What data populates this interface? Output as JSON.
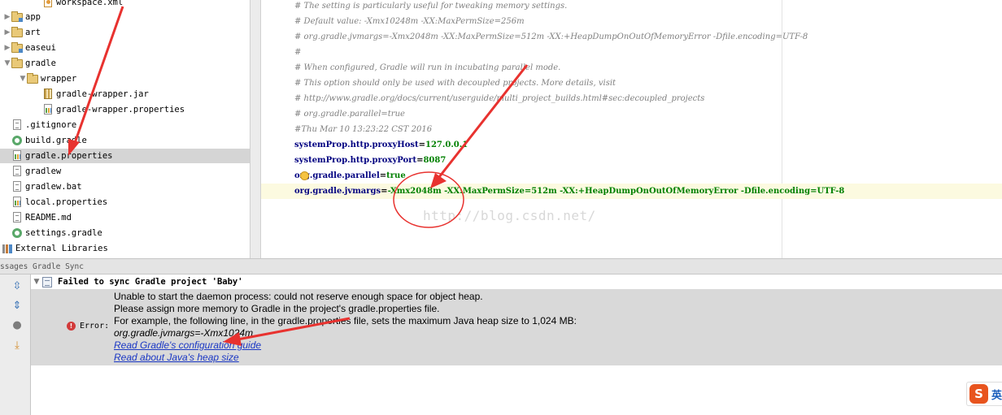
{
  "project_tree": {
    "items": [
      {
        "label": "workspace.xml",
        "icon": "xml-file-icon",
        "indent": 2,
        "expander": ""
      },
      {
        "label": "app",
        "icon": "module-folder-icon",
        "indent": 0,
        "expander": "▶"
      },
      {
        "label": "art",
        "icon": "folder-icon",
        "indent": 0,
        "expander": "▶"
      },
      {
        "label": "easeui",
        "icon": "module-folder-icon",
        "indent": 0,
        "expander": "▶"
      },
      {
        "label": "gradle",
        "icon": "folder-icon",
        "indent": 0,
        "expander": "▼"
      },
      {
        "label": "wrapper",
        "icon": "folder-icon",
        "indent": 1,
        "expander": "▼"
      },
      {
        "label": "gradle-wrapper.jar",
        "icon": "jar-file-icon",
        "indent": 2,
        "expander": ""
      },
      {
        "label": "gradle-wrapper.properties",
        "icon": "properties-file-icon",
        "indent": 2,
        "expander": ""
      },
      {
        "label": ".gitignore",
        "icon": "text-file-icon",
        "indent": 0,
        "expander": ""
      },
      {
        "label": "build.gradle",
        "icon": "gradle-file-icon",
        "indent": 0,
        "expander": ""
      },
      {
        "label": "gradle.properties",
        "icon": "properties-file-icon",
        "indent": 0,
        "expander": "",
        "selected": true
      },
      {
        "label": "gradlew",
        "icon": "text-file-icon",
        "indent": 0,
        "expander": ""
      },
      {
        "label": "gradlew.bat",
        "icon": "text-file-icon",
        "indent": 0,
        "expander": ""
      },
      {
        "label": "local.properties",
        "icon": "properties-file-icon",
        "indent": 0,
        "expander": ""
      },
      {
        "label": "README.md",
        "icon": "text-file-icon",
        "indent": 0,
        "expander": ""
      },
      {
        "label": "settings.gradle",
        "icon": "gradle-file-icon",
        "indent": 0,
        "expander": ""
      },
      {
        "label": "External Libraries",
        "icon": "libraries-icon",
        "indent": -1,
        "expander": ""
      }
    ]
  },
  "editor": {
    "lines": [
      {
        "kind": "comment",
        "text": "# The setting is particularly useful for tweaking memory settings."
      },
      {
        "kind": "comment",
        "text": "# Default value: -Xmx10248m -XX:MaxPermSize=256m"
      },
      {
        "kind": "comment",
        "text": "# org.gradle.jvmargs=-Xmx2048m -XX:MaxPermSize=512m -XX:+HeapDumpOnOutOfMemoryError -Dfile.encoding=UTF-8"
      },
      {
        "kind": "comment",
        "text": "#"
      },
      {
        "kind": "comment",
        "text": "# When configured, Gradle will run in incubating parallel mode."
      },
      {
        "kind": "comment",
        "text": "# This option should only be used with decoupled projects. More details, visit"
      },
      {
        "kind": "comment",
        "text": "# http://www.gradle.org/docs/current/userguide/multi_project_builds.html#sec:decoupled_projects"
      },
      {
        "kind": "comment",
        "text": "# org.gradle.parallel=true"
      },
      {
        "kind": "comment",
        "text": "#Thu Mar 10 13:23:22 CST 2016"
      },
      {
        "kind": "prop",
        "key": "systemProp.http.proxyHost",
        "value": "127.0.0.1"
      },
      {
        "kind": "prop",
        "key": "systemProp.http.proxyPort",
        "value": "8087"
      },
      {
        "kind": "prop",
        "key": "org.gradle.parallel",
        "value": "true",
        "bulb": true
      },
      {
        "kind": "prop",
        "key": "org.gradle.jvmargs",
        "value": "-Xmx2048m -XX:MaxPermSize=512m -XX:+HeapDumpOnOutOfMemoryError -Dfile.encoding=UTF-8",
        "current": true
      }
    ],
    "watermark": "http://blog.csdn.net/"
  },
  "messages": {
    "header": "ssages Gradle Sync",
    "title": "Failed to sync Gradle project 'Baby'",
    "error_label": "Error:",
    "lines": [
      {
        "text": "Unable to start the daemon process: could not reserve enough space for object heap.",
        "style": "plain"
      },
      {
        "text": "Please assign more memory to Gradle in the project's gradle.properties file.",
        "style": "plain"
      },
      {
        "text": "For example, the following line, in the gradle.properties file, sets the maximum Java heap size to 1,024 MB:",
        "style": "plain"
      },
      {
        "text": "org.gradle.jvmargs=-Xmx1024m",
        "style": "italic"
      },
      {
        "text": "Read Gradle's configuration guide",
        "style": "link"
      },
      {
        "text": "Read about Java's heap size",
        "style": "link"
      }
    ],
    "toolbar": [
      "expand-all-icon",
      "collapse-all-icon",
      "stop-icon",
      "export-icon"
    ]
  },
  "ime": {
    "logo": "S",
    "text": "英"
  },
  "colors": {
    "selection": "#d5d5d5",
    "comment": "#808080",
    "key": "#000080",
    "value": "#008000",
    "error_bg": "#d9d9d9",
    "link": "#1a37c4",
    "annotation": "#e8322f"
  }
}
